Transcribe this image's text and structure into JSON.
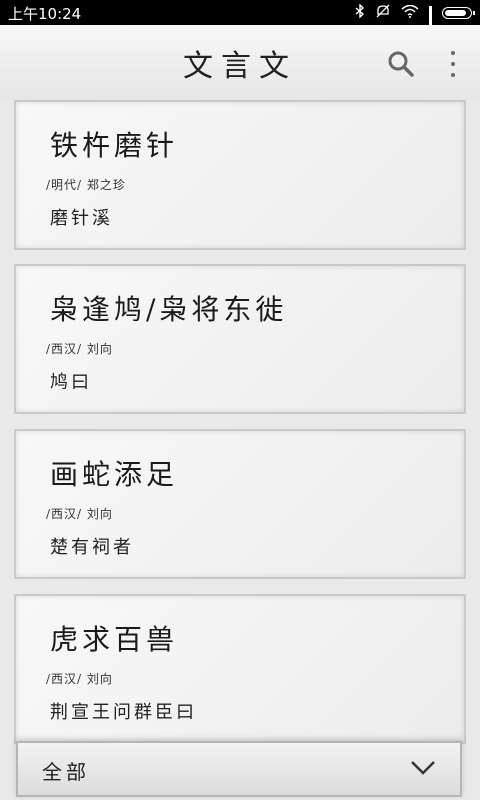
{
  "status_bar": {
    "time": "上午10:24",
    "battery_level": 0.9
  },
  "app_bar": {
    "title": "文言文",
    "icons": [
      "search-icon",
      "more-vertical-icon"
    ]
  },
  "articles": [
    {
      "title": "铁杵磨针",
      "meta": "/明代/ 郑之珍",
      "excerpt": "磨针溪"
    },
    {
      "title": "枭逢鸠/枭将东徙",
      "meta": "/西汉/ 刘向",
      "excerpt": "鸠曰"
    },
    {
      "title": "画蛇添足",
      "meta": "/西汉/ 刘向",
      "excerpt": "楚有祠者"
    },
    {
      "title": "虎求百兽",
      "meta": "/西汉/ 刘向",
      "excerpt": "荆宣王问群臣曰"
    }
  ],
  "filter": {
    "selected": "全部"
  },
  "colors": {
    "status_bar": "#000000",
    "background": "#e9e9e9",
    "text": "#1a1a1a"
  }
}
